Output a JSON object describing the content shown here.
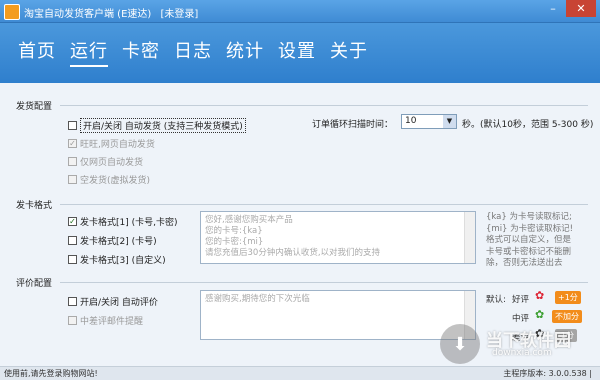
{
  "titlebar": {
    "title": "淘宝自动发货客户端 (E速达)",
    "login_status": "[未登录]"
  },
  "nav": [
    {
      "label": "首页"
    },
    {
      "label": "运行"
    },
    {
      "label": "卡密"
    },
    {
      "label": "日志"
    },
    {
      "label": "统计"
    },
    {
      "label": "设置"
    },
    {
      "label": "关于"
    }
  ],
  "ship_config": {
    "section_title": "发货配置",
    "auto_ship": {
      "label": "开启/关闭 自动发货 (支持三种发货模式)",
      "checked": false
    },
    "wangwang": {
      "label": "旺旺,网页自动发货",
      "checked": true
    },
    "web_only": {
      "label": "仅网页自动发货",
      "checked": false
    },
    "empty_ship": {
      "label": "空发货(虚拟发货)",
      "checked": false
    },
    "scan_label": "订单循环扫描时间：",
    "scan_value": "10",
    "scan_unit": "秒。(默认10秒，范围 5-300 秒)"
  },
  "card_format": {
    "section_title": "发卡格式",
    "options": [
      {
        "label": "发卡格式[1] (卡号,卡密)",
        "checked": true
      },
      {
        "label": "发卡格式[2] (卡号)",
        "checked": false
      },
      {
        "label": "发卡格式[3] (自定义)",
        "checked": false
      }
    ],
    "template_lines": [
      "您好,感谢您购买本产品",
      "您的卡号:{ka}",
      "您的卡密:{mi}",
      "请您充值后30分钟内确认收货,以对我们的支持"
    ],
    "help_lines": [
      "{ka} 为卡号读取标记;",
      "{mi} 为卡密读取标记!",
      "格式可以自定义，但是",
      "卡号或卡密标记不能删",
      "除，否则无法送出去"
    ]
  },
  "review_config": {
    "section_title": "评价配置",
    "auto_review": {
      "label": "开启/关闭 自动评价",
      "checked": false
    },
    "bad_review_alert": {
      "label": "中差评邮件提醒",
      "checked": false
    },
    "review_text": "感谢购买,期待您的下次光临",
    "default_label": "默认:",
    "ratings": [
      {
        "label": "好评",
        "badge": "+1分"
      },
      {
        "label": "中评",
        "badge": "不加分"
      },
      {
        "label": "差评",
        "badge": "-1分"
      }
    ]
  },
  "status": {
    "left": "使用前,请先登录购物网站!",
    "right": "主程序版本: 3.0.0.538 |"
  },
  "watermark": {
    "text": "当下软件园",
    "url": "downxia.com"
  }
}
